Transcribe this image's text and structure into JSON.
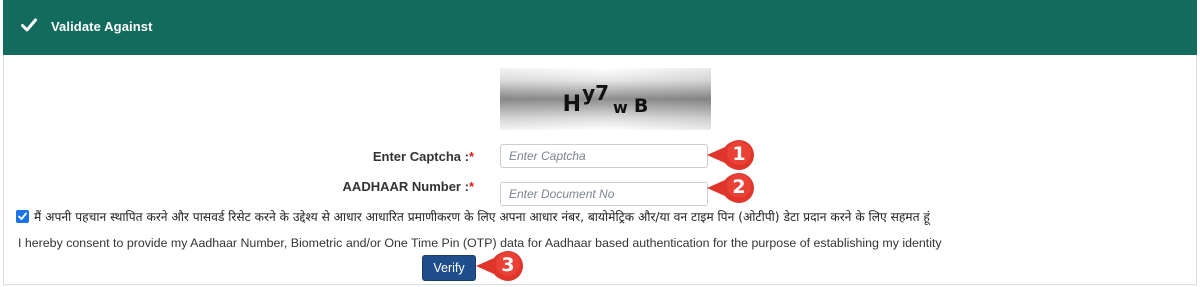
{
  "header": {
    "icon": "checkmark-icon",
    "title": "Validate Against",
    "background": "#136b5e"
  },
  "captcha": {
    "image_text_main": "H",
    "image_text_sup": "y7",
    "image_text_small": "w",
    "image_text_end": "B"
  },
  "form": {
    "captcha_label": "Enter Captcha :",
    "captcha_required": "*",
    "captcha_placeholder": "Enter Captcha",
    "captcha_value": "",
    "aadhaar_label": "AADHAAR Number :",
    "aadhaar_required": "*",
    "aadhaar_placeholder": "Enter Document No",
    "aadhaar_value": ""
  },
  "consent": {
    "checked": true,
    "hindi_text": "मैं अपनी पहचान स्थापित करने और पासवर्ड रिसेट करने के उद्देश्य से आधार आधारित प्रमाणीकरण के लिए अपना आधार नंबर, बायोमेट्रिक और/या वन टाइम पिन (ओटीपी) डेटा प्रदान करने के लिए सहमत हूं",
    "english_text": "I hereby consent to provide my Aadhaar Number, Biometric and/or One Time Pin (OTP) data for Aadhaar based authentication for the purpose of establishing my identity"
  },
  "actions": {
    "verify_label": "Verify",
    "verify_color": "#1f4e8c"
  },
  "annotations": {
    "marker_1": "1",
    "marker_2": "2",
    "marker_3": "3",
    "marker_color": "#e0352b"
  }
}
